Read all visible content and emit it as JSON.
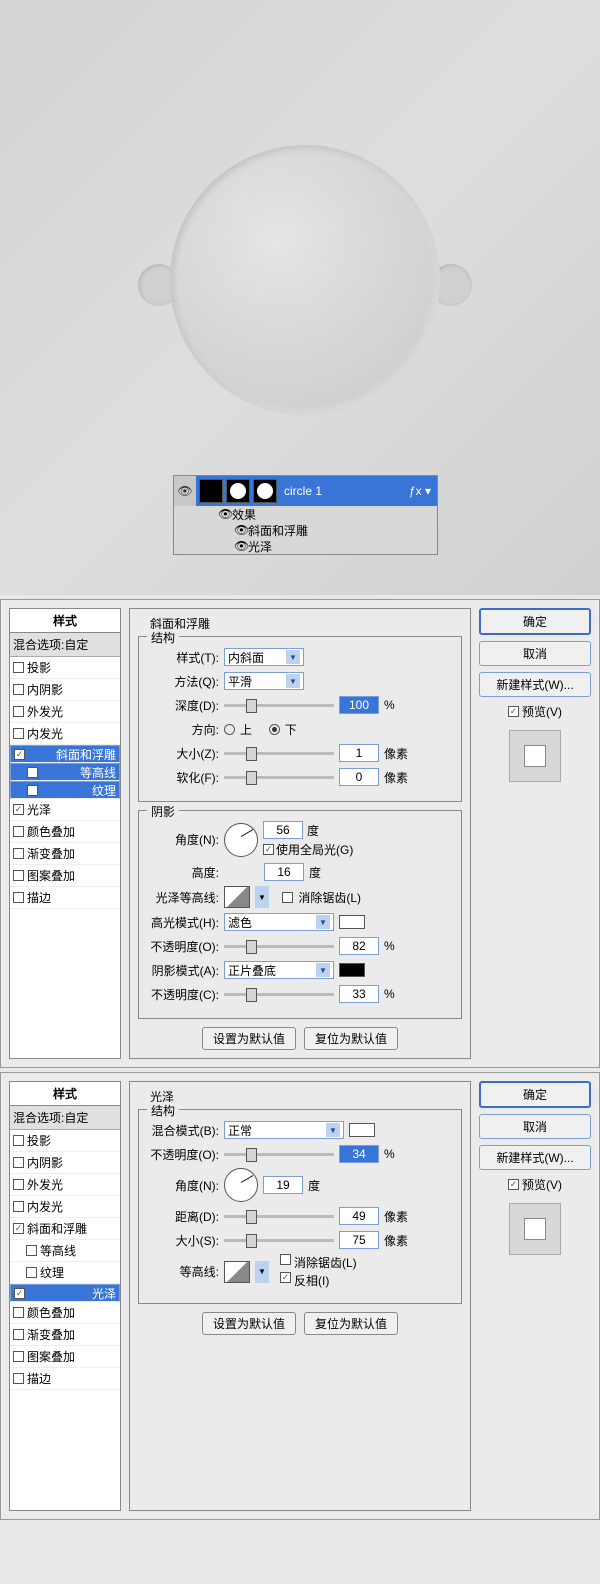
{
  "canvas": {
    "layer_name": "circle 1",
    "fx_header": "效果",
    "fx_bevel": "斜面和浮雕",
    "fx_satin": "光泽"
  },
  "styles": {
    "header": "样式",
    "blend": "混合选项:自定",
    "drop_shadow": "投影",
    "inner_shadow": "内阴影",
    "outer_glow": "外发光",
    "inner_glow": "内发光",
    "bevel": "斜面和浮雕",
    "contour": "等高线",
    "texture": "纹理",
    "satin": "光泽",
    "color_overlay": "颜色叠加",
    "grad_overlay": "渐变叠加",
    "pat_overlay": "图案叠加",
    "stroke": "描边"
  },
  "bevel": {
    "title": "斜面和浮雕",
    "struct": "结构",
    "style_lbl": "样式(T):",
    "style_val": "内斜面",
    "tech_lbl": "方法(Q):",
    "tech_val": "平滑",
    "depth_lbl": "深度(D):",
    "depth_val": "100",
    "pct": "%",
    "dir_lbl": "方向:",
    "up": "上",
    "down": "下",
    "size_lbl": "大小(Z):",
    "size_val": "1",
    "px": "像素",
    "soft_lbl": "软化(F):",
    "soft_val": "0",
    "shading": "阴影",
    "angle_lbl": "角度(N):",
    "angle_val": "56",
    "deg": "度",
    "global": "使用全局光(G)",
    "alt_lbl": "高度:",
    "alt_val": "16",
    "gloss_lbl": "光泽等高线:",
    "anti": "消除锯齿(L)",
    "hl_mode_lbl": "高光模式(H):",
    "hl_mode_val": "滤色",
    "hl_op_lbl": "不透明度(O):",
    "hl_op": "82",
    "sh_mode_lbl": "阴影模式(A):",
    "sh_mode_val": "正片叠底",
    "sh_op_lbl": "不透明度(C):",
    "sh_op": "33",
    "set_default": "设置为默认值",
    "reset_default": "复位为默认值"
  },
  "satin": {
    "title": "光泽",
    "struct": "结构",
    "mode_lbl": "混合模式(B):",
    "mode_val": "正常",
    "op_lbl": "不透明度(O):",
    "op_val": "34",
    "pct": "%",
    "angle_lbl": "角度(N):",
    "angle_val": "19",
    "deg": "度",
    "dist_lbl": "距离(D):",
    "dist_val": "49",
    "px": "像素",
    "size_lbl": "大小(S):",
    "size_val": "75",
    "contour_lbl": "等高线:",
    "anti": "消除锯齿(L)",
    "invert": "反相(I)",
    "set_default": "设置为默认值",
    "reset_default": "复位为默认值"
  },
  "btns": {
    "ok": "确定",
    "cancel": "取消",
    "new_style": "新建样式(W)...",
    "preview": "预览(V)"
  }
}
